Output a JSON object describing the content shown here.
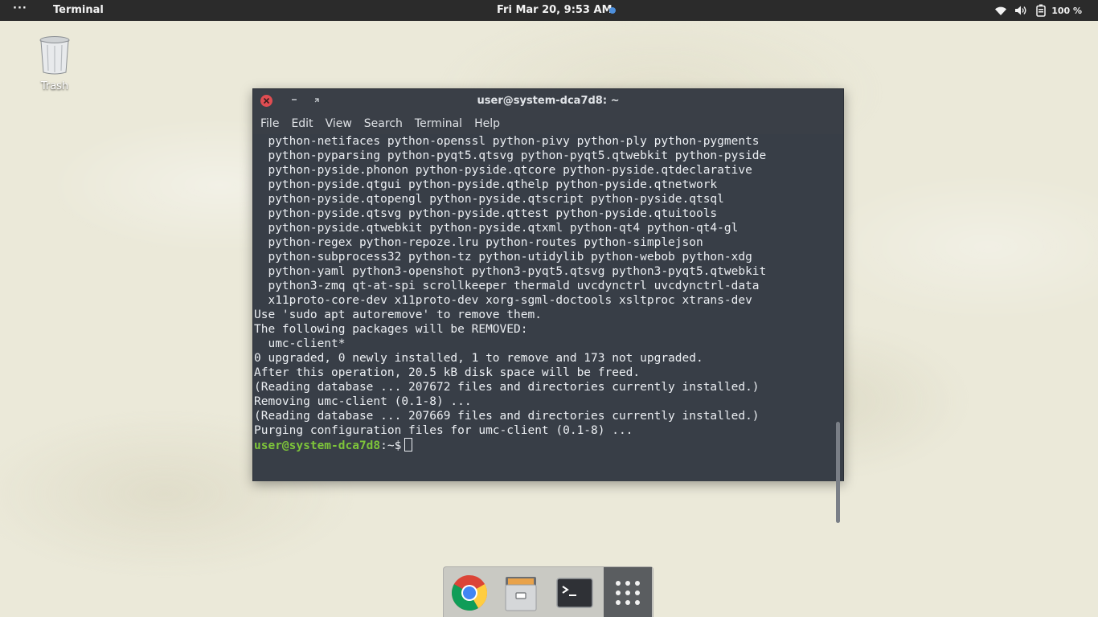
{
  "topbar": {
    "activities_label": "···",
    "app_name": "Terminal",
    "clock": "Fri Mar 20,  9:53 AM",
    "battery_percent": "100 %",
    "accent_color": "#4d8fdc"
  },
  "desktop": {
    "icons": [
      {
        "label": "Trash",
        "icon": "trash-icon"
      }
    ]
  },
  "terminal": {
    "title": "user@system-dca7d8: ~",
    "menu": [
      "File",
      "Edit",
      "View",
      "Search",
      "Terminal",
      "Help"
    ],
    "lines": [
      "  python-netifaces python-openssl python-pivy python-ply python-pygments",
      "  python-pyparsing python-pyqt5.qtsvg python-pyqt5.qtwebkit python-pyside",
      "  python-pyside.phonon python-pyside.qtcore python-pyside.qtdeclarative",
      "  python-pyside.qtgui python-pyside.qthelp python-pyside.qtnetwork",
      "  python-pyside.qtopengl python-pyside.qtscript python-pyside.qtsql",
      "  python-pyside.qtsvg python-pyside.qttest python-pyside.qtuitools",
      "  python-pyside.qtwebkit python-pyside.qtxml python-qt4 python-qt4-gl",
      "  python-regex python-repoze.lru python-routes python-simplejson",
      "  python-subprocess32 python-tz python-utidylib python-webob python-xdg",
      "  python-yaml python3-openshot python3-pyqt5.qtsvg python3-pyqt5.qtwebkit",
      "  python3-zmq qt-at-spi scrollkeeper thermald uvcdynctrl uvcdynctrl-data",
      "  x11proto-core-dev x11proto-dev xorg-sgml-doctools xsltproc xtrans-dev",
      "Use 'sudo apt autoremove' to remove them.",
      "The following packages will be REMOVED:",
      "  umc-client*",
      "0 upgraded, 0 newly installed, 1 to remove and 173 not upgraded.",
      "After this operation, 20.5 kB disk space will be freed.",
      "(Reading database ... 207672 files and directories currently installed.)",
      "Removing umc-client (0.1-8) ...",
      "(Reading database ... 207669 files and directories currently installed.)",
      "Purging configuration files for umc-client (0.1-8) ..."
    ],
    "prompt_user": "user@system-dca7d8",
    "prompt_path": ":~$",
    "prompt_color": "#7ec53a"
  },
  "dock": {
    "items": [
      {
        "name": "chrome-icon",
        "running": false
      },
      {
        "name": "files-icon",
        "running": true
      },
      {
        "name": "terminal-icon",
        "running": true
      },
      {
        "name": "apps-grid-icon",
        "running": false
      }
    ]
  }
}
